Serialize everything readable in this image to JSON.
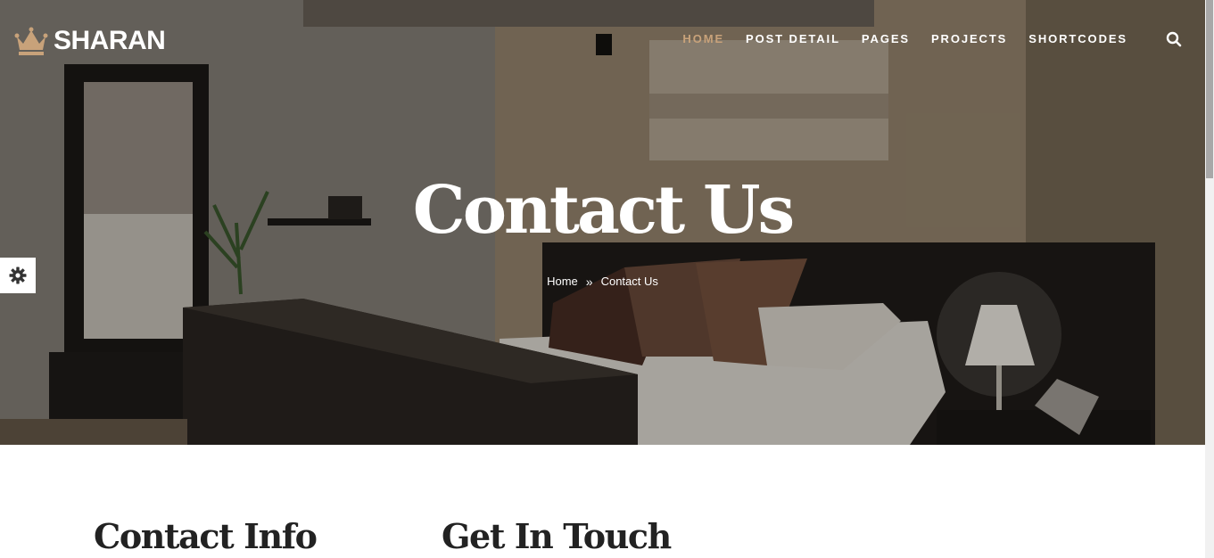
{
  "header": {
    "brand": "SHARAN",
    "nav": [
      {
        "label": "HOME",
        "active": true
      },
      {
        "label": "POST DETAIL",
        "active": false
      },
      {
        "label": "PAGES",
        "active": false
      },
      {
        "label": "PROJECTS",
        "active": false
      },
      {
        "label": "SHORTCODES",
        "active": false
      }
    ],
    "search_icon": "search-icon"
  },
  "hero": {
    "title": "Contact Us",
    "breadcrumb": {
      "home": "Home",
      "separator": "»",
      "current": "Contact Us"
    }
  },
  "settings_icon": "gear-icon",
  "sections": {
    "contact_info_title": "Contact Info",
    "get_in_touch_title": "Get In Touch"
  },
  "colors": {
    "accent": "#c8a27a",
    "heading": "#222222",
    "white": "#ffffff"
  }
}
